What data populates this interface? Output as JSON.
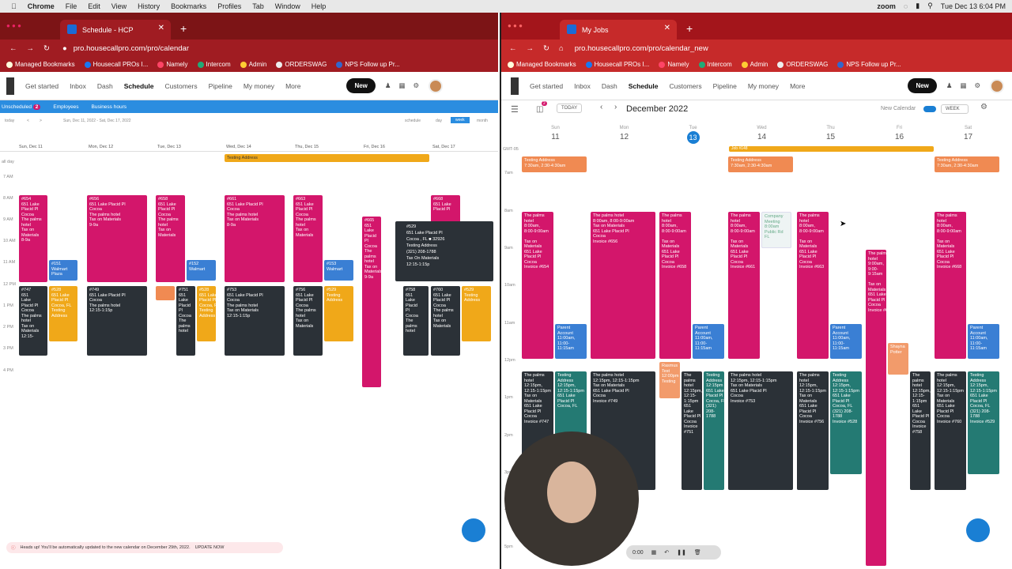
{
  "menubar": {
    "app": "Chrome",
    "items": [
      "File",
      "Edit",
      "View",
      "History",
      "Bookmarks",
      "Profiles",
      "Tab",
      "Window",
      "Help"
    ],
    "zoom": "zoom",
    "datetime": "Tue Dec 13  6:04 PM"
  },
  "bookmarks": [
    "Managed Bookmarks",
    "Housecall PROs I...",
    "Namely",
    "Intercom",
    "Admin",
    "ORDERSWAG",
    "NPS Follow up Pr..."
  ],
  "nav": {
    "get_started": "Get started",
    "inbox": "Inbox",
    "dash": "Dash",
    "schedule": "Schedule",
    "customers": "Customers",
    "pipeline": "Pipeline",
    "my_money": "My money",
    "more": "More",
    "new": "New",
    "badge": "1"
  },
  "left": {
    "tab_title": "Schedule - HCP",
    "url": "pro.housecallpro.com/pro/calendar",
    "bar": {
      "unscheduled": "Unscheduled",
      "unscheduled_count": "2",
      "employees": "Employees",
      "business_hours": "Business hours"
    },
    "controls": {
      "today": "today",
      "prev": "<",
      "next": ">",
      "range": "Sun, Dec 11, 2022 - Sat, Dec 17, 2022",
      "views": [
        "schedule",
        "day",
        "week",
        "month"
      ],
      "active_view": "week"
    },
    "allday": "all day",
    "days": [
      "Sun, Dec 11",
      "Mon, Dec 12",
      "Tue, Dec 13",
      "Wed, Dec 14",
      "Thu, Dec 15",
      "Fri, Dec 16",
      "Sat, Dec 17"
    ],
    "hours": [
      "7 AM",
      "8 AM",
      "9 AM",
      "10 AM",
      "11 AM",
      "12 PM",
      "1 PM",
      "2 PM",
      "3 PM",
      "4 PM"
    ],
    "allday_event": "Testing Address",
    "events": {
      "e654": "#654\n651 Lake\nPlacid Pl\nCocoa\nThe palms\nhotel\nTax on\nMaterials\n8-9a",
      "e656": "#656\n651 Lake Placid Pl\nCocoa\nThe palms hotel\nTax on Materials\n9-9a",
      "e658": "#658\n651 Lake\nPlacid Pl\nCocoa\nThe palms\nhotel\nTax on\nMaterials",
      "e661": "#661\n651 Lake Placid Pl\nCocoa\nThe palms hotel\nTax on Materials\n8-9a",
      "e663": "#663\n651 Lake\nPlacid Pl\nCocoa\nThe palms\nhotel\nTax on\nMaterials",
      "e665": "#665\n651\nLake\nPlacid\nPl\nCocoa\nThe\npalms\nhotel\nTax on\nMaterials\n9-9a",
      "e668": "#668\n651 Lake\nPlacid Pl",
      "w151": "#151\nWalmart\nPlaza",
      "w152": "#152\nWalmart",
      "w153": "#153\nWalmart",
      "e747": "#747\n651\nLake\nPlacid Pl\nCocoa\nThe palms\nhotel\nTax on\nMaterials\n12:15-",
      "e528": "#528\n651 Lake\nPlacid Pl\nCocoa, FL\nTesting\nAddress",
      "e749": "#749\n651 Lake Placid Pl\nCocoa\nThe palms hotel\n12:15-1:15p",
      "e751": "#751\n651\nLake\nPlacid\nPl\nCocoa\nThe\npalms\nhotel",
      "e753": "#753\n651 Lake Placid Pl\nCocoa\nThe palms hotel\nTax on Materials\n12:15-1:15p",
      "e756": "#756\n651 Lake\nPlacid Pl\nCocoa\nThe palms\nhotel\nTax on\nMaterials",
      "e529": "#529\nTesting\nAddress",
      "e758": "#758\n651\nLake\nPlacid\nPl\nCocoa\nThe\npalms\nhotel",
      "e760": "#760\n651 Lake\nPlacid Pl\nCocoa\nThe palms\nhotel\nTax on\nMaterials"
    },
    "popup": [
      "#529",
      "651 Lake Placid Pl",
      "Cocoa , FL",
      "32926",
      "Testing Address",
      "(321) 208-1788",
      "Tax On Materials",
      "12:15-1:15p"
    ],
    "banner": {
      "text": "Heads up! You'll be automatically updated to the new calendar on December 29th, 2022.",
      "action": "UPDATE NOW"
    }
  },
  "right": {
    "tab_title": "My Jobs",
    "url": "pro.housecallpro.com/pro/calendar_new",
    "toolbar": {
      "today": "TODAY",
      "month": "December 2022",
      "new_calendar": "New Calendar",
      "view": "WEEK",
      "count": "2"
    },
    "timezone": "GMT-05",
    "day_names": [
      "Sun",
      "Mon",
      "Tue",
      "Wed",
      "Thu",
      "Fri",
      "Sat"
    ],
    "day_nums": [
      "11",
      "12",
      "13",
      "14",
      "15",
      "16",
      "17"
    ],
    "hours": [
      "7am",
      "8am",
      "9am",
      "10am",
      "11am",
      "12pm",
      "1pm",
      "2pm",
      "3pm",
      "4pm",
      "5pm"
    ],
    "job_bar": "Job #148",
    "events": {
      "ta1": "Testing Address\n7:30am, 2:30-4:30am",
      "ta2": "Testing Address\n7:30am, 2:30-4:30am",
      "ta3": "Testing Address\n7:30am, 2:30-4:30am",
      "palms_sun": "The palms\nhotel\n8:00am,\n8:00-9:00am\n\nTax on\nMaterials\n651 Lake\nPlacid Pl\nCocoa\nInvoice #654",
      "palms_mon": "The palms hotel\n8:00am, 8:00-9:00am\nTax on Materials\n651 Lake Placid Pl\nCocoa\nInvoice #656",
      "palms_tue": "The palms\nhotel\n8:00am,\n8:00-9:00am\n\nTax on\nMaterials\n651 Lake\nPlacid Pl\nCocoa\nInvoice #658",
      "palms_wed": "The palms\nhotel\n8:00am,\n8:00-9:00am\n\nTax on\nMaterials\n651 Lake\nPlacid Pl\nCocoa\nInvoice #661",
      "meeting": "Company\nMeeting\n8:00am\nPublic Rd\nFL",
      "palms_thu": "The palms\nhotel\n8:00am,\n8:00-9:00am\n\nTax on\nMaterials\n651 Lake\nPlacid Pl\nCocoa\nInvoice #663",
      "palms_fri": "The palms\nhotel\n9:00am,\n9:00-\n9:15am\n\nTax on\nMaterials\n651 Lake\nPlacid Pl\nCocoa\nInvoice #665",
      "palms_sat": "The palms\nhotel\n8:00am,\n8:00-9:00am\n\nTax on\nMaterials\n651 Lake\nPlacid Pl\nCocoa\nInvoice #668",
      "pa_sun": "Parent\nAccount\n11:00am,\n11:00-\n11:15am",
      "pa_tue": "Parent\nAccount\n11:00am,\n11:00-\n11:15am",
      "pa_thu": "Parent\nAccount\n11:00am,\n11:00-\n11:15am",
      "pa_sat": "Parent\nAccount\n11:00am,\n11:00-\n11:15am",
      "dk_sun": "The palms\nhotel\n12:15pm,\n12:15-1:15pm\nTax on\nMaterials\n651 Lake\nPlacid Pl\nCocoa\nInvoice #747",
      "tl_sun": "Testing\nAddress\n12:15pm,\n12:15-1:15pm\n651 Lake\nPlacid Pl\nCocoa, FL",
      "dk_mon": "The palms hotel\n12:15pm, 12:15-1:15pm\nTax on Materials\n651 Lake Placid Pl\nCocoa\nInvoice #749",
      "dk_tue": "The\npalms\nhotel\n12:15pm,\n12:15-\n1:15pm\n651\nLake\nPlacid Pl\nCocoa\nInvoice\n#751",
      "tl_tue": "Testing\nAddress\n12:15pm\n651 Lake\nPlacid Pl\nCocoa, FL\n(321)\n208-\n1788",
      "dk_wed": "The palms hotel\n12:15pm, 12:15-1:15pm\nTax on Materials\n651 Lake Placid Pl\nCocoa\nInvoice #753",
      "dk_thu": "The palms\nhotel\n12:15pm,\n12:15-1:15pm\nTax on\nMaterials\n651 Lake\nPlacid Pl\nCocoa\nInvoice #756",
      "tl_thu": "Testing\nAddress\n12:15pm,\n12:15-1:15pm\n651 Lake\nPlacid Pl\nCocoa, FL\n(321) 208-\n1788\nInvoice #528",
      "dk_fri": "The\npalms\nhotel\n12:15pm,\n12:15-\n1:15pm\n651\nLake\nPlacid Pl\nCocoa\nInvoice\n#758",
      "dk_sat": "The palms\nhotel\n12:15pm,\n12:15-1:15pm\nTax on\nMaterials\n651 Lake\nPlacid Pl\nCocoa\nInvoice #760",
      "tl_sat": "Testing\nAddress\n12:15pm,\n12:15-1:15pm\n651 Lake\nPlacid Pl\nCocoa, FL\n(321) 208-\n1788\nInvoice #529",
      "shayna": "Shayna\nPotter",
      "rasmus": "Rasmus\nTest\n12:00pm\nTesting"
    },
    "recorder": {
      "time": "0:00"
    }
  },
  "colors": {
    "pink": "#d3166b",
    "dark": "#2b3137",
    "yellow": "#f0a819",
    "orange": "#f08a52",
    "blue": "#3a7fd4",
    "teal": "#247a73",
    "left_chrome": "#7c1416",
    "right_chrome": "#a3151b",
    "accent": "#2b8de0"
  }
}
